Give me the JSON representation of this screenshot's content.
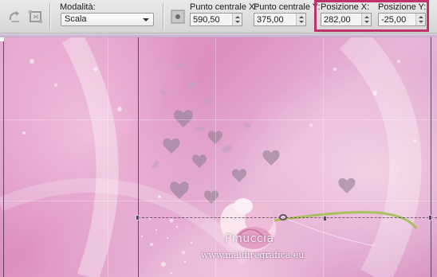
{
  "toolbar": {
    "mode": {
      "label": "Modalità:",
      "value": "Scala"
    },
    "center_x": {
      "label": "Punto centrale X:",
      "value": "590,50"
    },
    "center_y": {
      "label": "Punto centrale Y:",
      "value": "375,00"
    },
    "pos_x": {
      "label": "Posizione X:",
      "value": "282,00"
    },
    "pos_y": {
      "label": "Posizione Y:",
      "value": "-25,00"
    },
    "icons": [
      "reset-icon",
      "deform-settings-icon"
    ],
    "highlight_color": "#c0316d"
  },
  "canvas": {
    "watermark_name": "Pinuccia",
    "watermark_url": "www.maidiregrafica.eu"
  }
}
